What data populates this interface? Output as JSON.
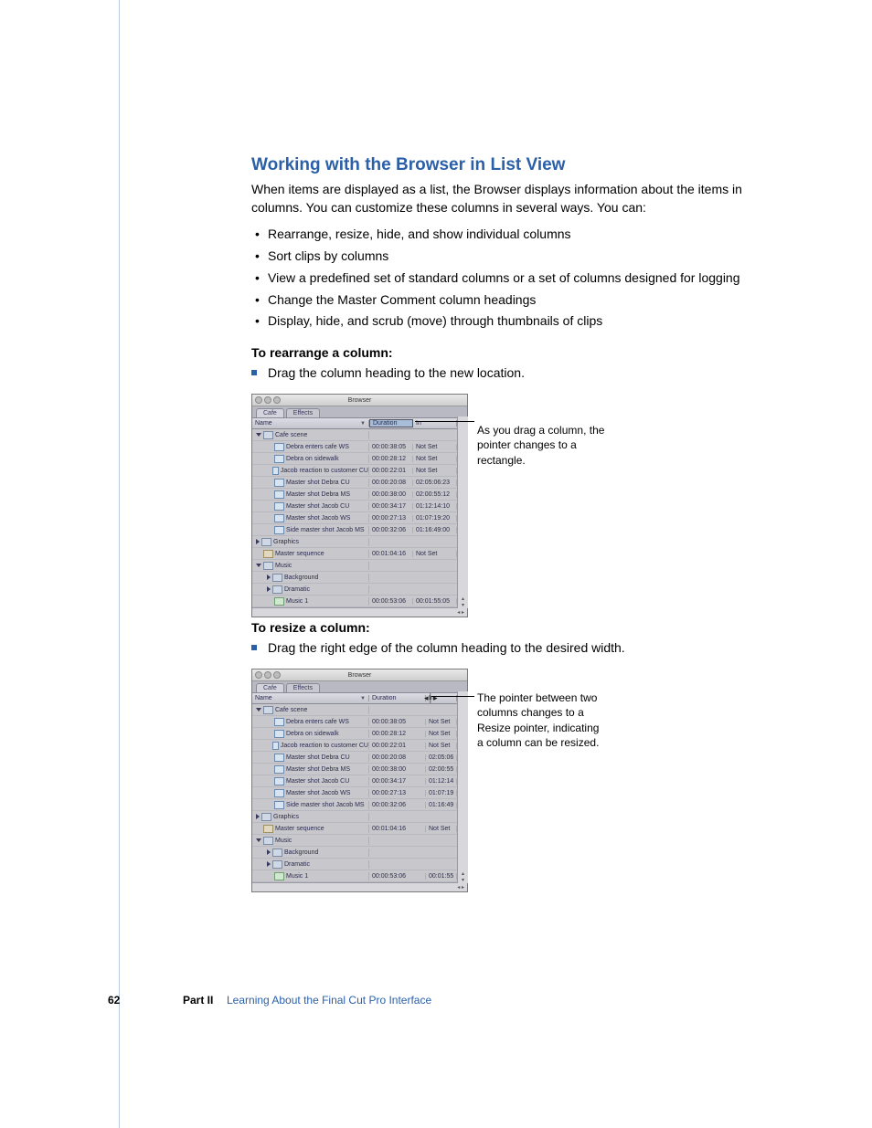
{
  "section": {
    "title": "Working with the Browser in List View",
    "intro": "When items are displayed as a list, the Browser displays information about the items in columns. You can customize these columns in several ways. You can:",
    "bullets": [
      "Rearrange, resize, hide, and show individual columns",
      "Sort clips by columns",
      "View a predefined set of standard columns or a set of columns designed for logging",
      "Change the Master Comment column headings",
      "Display, hide, and scrub (move) through thumbnails of clips"
    ]
  },
  "task1": {
    "heading": "To rearrange a column:",
    "step": "Drag the column heading to the new location.",
    "caption": "As you drag a column, the pointer changes to a rectangle."
  },
  "task2": {
    "heading": "To resize a column:",
    "step": "Drag the right edge of the column heading to the desired width.",
    "caption": "The pointer between two columns changes to a Resize pointer, indicating a column can be resized."
  },
  "browser": {
    "window_title": "Browser",
    "tabs": [
      "Cafe",
      "Effects"
    ],
    "columns": {
      "name": "Name",
      "duration": "Duration",
      "in": "In"
    },
    "rows": [
      {
        "type": "bin",
        "level": 1,
        "open": true,
        "name": "Cafe scene",
        "dur": "",
        "in": ""
      },
      {
        "type": "clip",
        "level": 2,
        "name": "Debra enters cafe WS",
        "dur": "00:00:38:05",
        "in": "Not Set"
      },
      {
        "type": "clip",
        "level": 2,
        "name": "Debra on sidewalk",
        "dur": "00:00:28:12",
        "in": "Not Set"
      },
      {
        "type": "clip",
        "level": 2,
        "name": "Jacob reaction to customer CU",
        "dur": "00:00:22:01",
        "in": "Not Set"
      },
      {
        "type": "clip",
        "level": 2,
        "name": "Master shot Debra CU",
        "dur": "00:00:20:08",
        "in": "02:05:06:23"
      },
      {
        "type": "clip",
        "level": 2,
        "name": "Master shot Debra MS",
        "dur": "00:00:38:00",
        "in": "02:00:55:12"
      },
      {
        "type": "clip",
        "level": 2,
        "name": "Master shot Jacob CU",
        "dur": "00:00:34:17",
        "in": "01:12:14:10"
      },
      {
        "type": "clip",
        "level": 2,
        "name": "Master shot Jacob WS",
        "dur": "00:00:27:13",
        "in": "01:07:19:20"
      },
      {
        "type": "clip",
        "level": 2,
        "name": "Side master shot Jacob MS",
        "dur": "00:00:32:06",
        "in": "01:16:49:00"
      },
      {
        "type": "bin",
        "level": 1,
        "open": false,
        "name": "Graphics",
        "dur": "",
        "in": ""
      },
      {
        "type": "seq",
        "level": 1,
        "name": "Master sequence",
        "dur": "00:01:04:16",
        "in": "Not Set"
      },
      {
        "type": "bin",
        "level": 1,
        "open": true,
        "name": "Music",
        "dur": "",
        "in": ""
      },
      {
        "type": "bin",
        "level": 2,
        "open": false,
        "name": "Background",
        "dur": "",
        "in": ""
      },
      {
        "type": "bin",
        "level": 2,
        "open": false,
        "name": "Dramatic",
        "dur": "",
        "in": ""
      },
      {
        "type": "aud",
        "level": 2,
        "name": "Music 1",
        "dur": "00:00:53:06",
        "in": "00:01:55:05"
      }
    ]
  },
  "browser2_in_override": {
    "4": "02:05:06",
    "5": "02:00:55",
    "6": "01:12:14",
    "7": "01:07:19",
    "8": "01:16:49",
    "14": "00:01:55"
  },
  "footer": {
    "page": "62",
    "part": "Part II",
    "chapter": "Learning About the Final Cut Pro Interface"
  }
}
